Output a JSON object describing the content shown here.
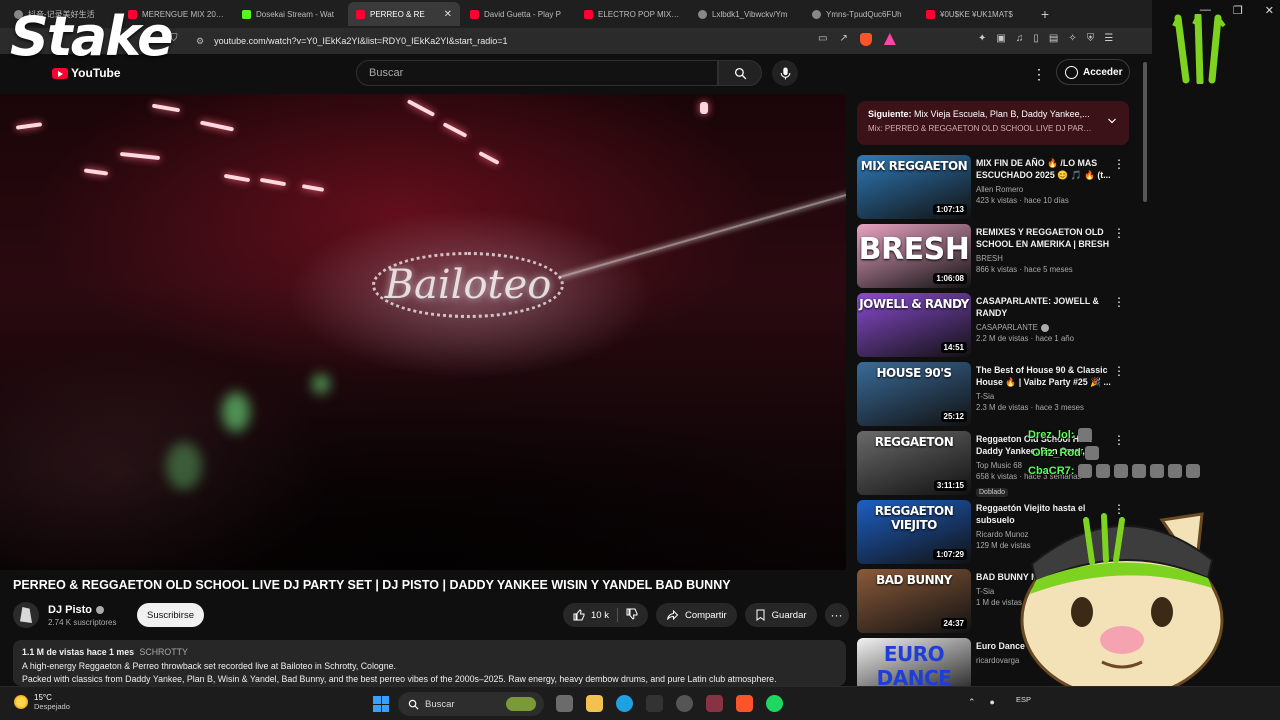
{
  "browser": {
    "tabs": [
      {
        "title": "抖音-记录美好生活",
        "favicon": "gen",
        "active": false
      },
      {
        "title": "MERENGUE MIX 2025",
        "favicon": "yt",
        "active": false
      },
      {
        "title": "Dosekai Stream - Wat",
        "favicon": "kick",
        "active": false
      },
      {
        "title": "PERREO & RE",
        "favicon": "yt",
        "active": true
      },
      {
        "title": "David Guetta - Play P",
        "favicon": "yt",
        "active": false
      },
      {
        "title": "ELECTRO POP MIX 20",
        "favicon": "yt",
        "active": false
      },
      {
        "title": "Lxlbdk1_Vibwckv/Ym",
        "favicon": "gen",
        "active": false
      },
      {
        "title": "Ymns-TpudQuc6FUh",
        "favicon": "gen",
        "active": false
      },
      {
        "title": "¥0U$KE ¥UK1MAT$",
        "favicon": "yt",
        "active": false
      }
    ],
    "new_tab": "+",
    "url": "youtube.com/watch?v=Y0_IEkKa2YI&list=RDY0_IEkKa2YI&start_radio=1"
  },
  "overlay": {
    "stake_logo": "Stake",
    "chat": [
      {
        "user": "Drez_lol:",
        "text": ""
      },
      {
        "user": "Oriz_Rod",
        "text": ""
      },
      {
        "user": "CbaCR7:",
        "text": ""
      }
    ]
  },
  "youtube": {
    "logo_text": "YouTube",
    "search_placeholder": "Buscar",
    "signin_label": "Acceder",
    "video": {
      "title": "PERREO & REGGAETON OLD SCHOOL LIVE DJ PARTY SET | DJ PISTO | DADDY YANKEE WISIN Y YANDEL BAD BUNNY",
      "stage_sign": "Bailoteo",
      "channel_name": "DJ Pisto",
      "subscribers": "2.74 K suscriptores",
      "subscribe_label": "Suscribirse",
      "likes": "10 k",
      "share_label": "Compartir",
      "save_label": "Guardar",
      "more": "···",
      "views": "1.1 M de vistas",
      "age": "hace 1 mes",
      "tag": "SCHROTTY",
      "description_1": "A high-energy Reggaeton & Perreo throwback set recorded live at Bailoteo in Schrotty, Cologne.",
      "description_2": "Packed with classics from Daddy Yankee, Plan B, Wisin & Yandel, Bad Bunny, and the best perreo vibes of the 2000s–2025. Raw energy, heavy dembow drums, and pure Latin club atmosphere."
    },
    "up_next": {
      "prefix": "Siguiente:",
      "title": "Mix Vieja Escuela, Plan B, Daddy Yankee,...",
      "mix": "Mix: PERREO & REGGAETON OLD SCHOOL LIVE DJ PARTY S..."
    },
    "recommendations": [
      {
        "title": "MIX FIN DE AÑO 🔥 /LO MAS ESCUCHADO 2025 😊 🎵 🔥 (t...",
        "channel": "Allen Romero",
        "meta": "423 k vistas · hace 10 días",
        "duration": "1:07:13",
        "thumb_text": "MIX REGGAETON",
        "thumb_color": "#2e7ab8",
        "verified": false,
        "badge": ""
      },
      {
        "title": "REMIXES Y REGGAETON OLD SCHOOL EN AMERIKA | BRESH",
        "channel": "BRESH",
        "meta": "866 k vistas · hace 5 meses",
        "duration": "1:06:08",
        "thumb_text": "BRESH",
        "thumb_color": "#e9a3c2",
        "verified": false,
        "badge": ""
      },
      {
        "title": "CASAPARLANTE: JOWELL & RANDY",
        "channel": "CASAPARLANTE",
        "meta": "2.2 M de vistas · hace 1 año",
        "duration": "14:51",
        "thumb_text": "JOWELL & RANDY",
        "thumb_color": "#8a4bd1",
        "verified": true,
        "badge": ""
      },
      {
        "title": "The Best of House 90 & Classic House 🔥 | Vaibz Party #25 🎉 ...",
        "channel": "T-Sia",
        "meta": "2.3 M de vistas · hace 3 meses",
        "duration": "25:12",
        "thumb_text": "HOUSE 90'S",
        "thumb_color": "#3a6b9a",
        "verified": false,
        "badge": ""
      },
      {
        "title": "Reggaeton Old School Hits: Daddy Yankee, Don Omar, ...",
        "channel": "Top Music 68",
        "meta": "658 k vistas · hace 3 semanas",
        "duration": "3:11:15",
        "thumb_text": "REGGAETON",
        "thumb_color": "#6a6a6a",
        "verified": false,
        "badge": "Doblado"
      },
      {
        "title": "Reggaetón Viejito hasta el subsuelo",
        "channel": "Ricardo Munoz",
        "meta": "129 M de vistas",
        "duration": "1:07:29",
        "thumb_text": "REGGAETON VIEJITO",
        "thumb_color": "#1d5fc4",
        "verified": false,
        "badge": ""
      },
      {
        "title": "BAD BUNNY MIX NEW ALBUM",
        "channel": "T-Sia",
        "meta": "1 M de vistas",
        "duration": "24:37",
        "thumb_text": "BAD BUNNY",
        "thumb_color": "#8a5a3a",
        "verified": false,
        "badge": ""
      },
      {
        "title": "Euro Dance 90s Technotronic",
        "channel": "ricardovarga",
        "meta": "",
        "duration": "",
        "thumb_text": "EURO DANCE",
        "thumb_color": "#f2f2f2",
        "verified": false,
        "badge": ""
      }
    ]
  },
  "taskbar": {
    "temperature": "15°C",
    "weather": "Despejado",
    "search_label": "Buscar",
    "lang": "ESP"
  },
  "colors": {
    "yt_red": "#ff0033",
    "up_next_bg": "#3a1218",
    "chat_green": "#59ff59",
    "monster_green": "#7ed321"
  }
}
